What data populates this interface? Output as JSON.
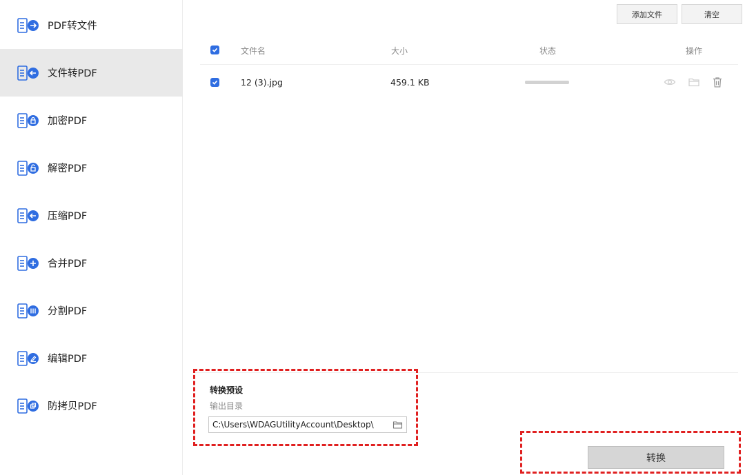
{
  "sidebar": {
    "items": [
      {
        "label": "PDF转文件",
        "icon": "arrow-right-icon"
      },
      {
        "label": "文件转PDF",
        "icon": "arrow-left-icon",
        "active": true
      },
      {
        "label": "加密PDF",
        "icon": "lock-icon"
      },
      {
        "label": "解密PDF",
        "icon": "unlock-icon"
      },
      {
        "label": "压缩PDF",
        "icon": "arrow-left-icon"
      },
      {
        "label": "合并PDF",
        "icon": "plus-icon"
      },
      {
        "label": "分割PDF",
        "icon": "split-icon"
      },
      {
        "label": "编辑PDF",
        "icon": "pencil-icon"
      },
      {
        "label": "防拷贝PDF",
        "icon": "copy-icon"
      }
    ]
  },
  "toolbar": {
    "add_files_label": "添加文件",
    "clear_label": "清空"
  },
  "table": {
    "headers": {
      "name": "文件名",
      "size": "大小",
      "status": "状态",
      "actions": "操作"
    },
    "rows": [
      {
        "name": "12 (3).jpg",
        "size": "459.1 KB",
        "progress": 0
      }
    ]
  },
  "preset": {
    "title": "转换预设",
    "output_dir_label": "输出目录",
    "output_path": "C:\\Users\\WDAGUtilityAccount\\Desktop\\"
  },
  "convert_label": "转换",
  "colors": {
    "accent": "#2f6de1",
    "active_bg": "#e9e9e9",
    "highlight": "#e02020"
  }
}
